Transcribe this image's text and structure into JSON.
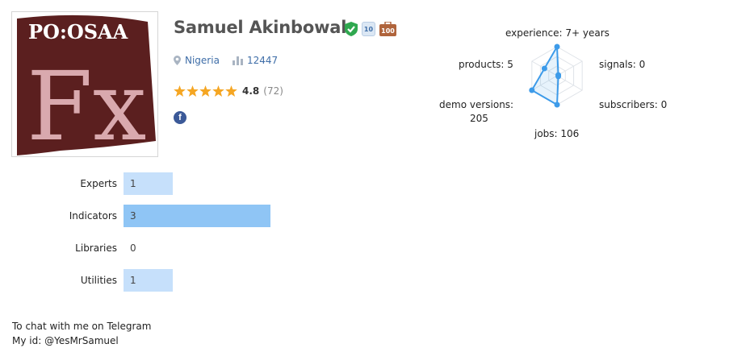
{
  "profile": {
    "name": "Samuel Akinbowale",
    "country": "Nigeria",
    "rank": "12447",
    "rating_value": "4.8",
    "rating_count": "(72)",
    "stars": 5,
    "badge_years": "10",
    "badge_jobs": "100",
    "logo_text_top": "PO:OSAA",
    "logo_text_main": "Fx"
  },
  "radar": {
    "labels": {
      "experience": "experience: 7+ years",
      "signals": "signals: 0",
      "subscribers": "subscribers: 0",
      "jobs": "jobs: 106",
      "demo_line1": "demo versions:",
      "demo_line2": "205",
      "products": "products: 5"
    },
    "levels": {
      "experience": 1.0,
      "signals": 0.0,
      "subscribers": 0.0,
      "jobs": 1.0,
      "demo_versions": 1.0,
      "products": 0.5
    }
  },
  "bars": [
    {
      "label": "Experts",
      "value": "1",
      "fraction": 0.333
    },
    {
      "label": "Indicators",
      "value": "3",
      "fraction": 1.0
    },
    {
      "label": "Libraries",
      "value": "0",
      "fraction": 0
    },
    {
      "label": "Utilities",
      "value": "1",
      "fraction": 0.333
    }
  ],
  "about": {
    "line1": "To chat with me on Telegram",
    "line2": "My id: @YesMrSamuel"
  },
  "colors": {
    "accent": "#3f6ea8",
    "bar_light": "#c6e0fb",
    "bar_strong": "#8fc5f5",
    "radar_line": "#3d9be9",
    "logo_bg": "#5b1f1f",
    "logo_text": "#d9a9ae",
    "star": "#f5a623",
    "verified": "#2fa84f",
    "bag": "#b0643c"
  }
}
